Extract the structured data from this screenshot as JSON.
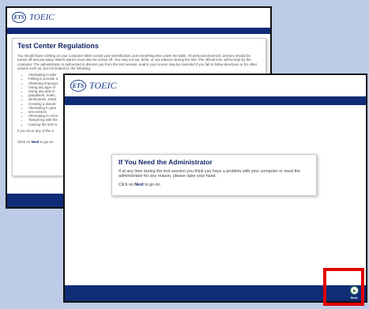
{
  "colors": {
    "brand_navy": "#0f2c77",
    "background": "#bccbe6",
    "highlight": "#e00000"
  },
  "back_window": {
    "logo_mark": "ETS",
    "logo_text": "TOEIC",
    "title": "Test Center Regulations",
    "intro": "You should have nothing on your computer table except your identification; put everything else under the table. All personal electronic devices should be turned off and put away. Watch alarms must also be turned off. You may not eat, drink, or use tobacco during the test. The official time will be kept by the computer. The administrator is authorized to dismiss you from the test session, and/or your scores may be canceled if you fail to follow directions or for other actions such as, but not limited to, the following:",
    "rules": [
      "Attempting to take",
      "Failing to provide a",
      "Obtaining improper",
      "Using any type of",
      "Using any aids in",
      "pamphlets, notes,",
      "dictionaries, transl",
      "Creating a disturb",
      "Attempting to give",
      "test session",
      "Attempting to remo",
      "Tampering with the",
      "Leaving the test ro"
    ],
    "note": "If you incur any of the a",
    "click_prefix": "Click on ",
    "click_next": "Next",
    "click_suffix": " to go on."
  },
  "front_window": {
    "logo_mark": "ETS",
    "logo_text": "TOEIC",
    "dialog": {
      "title": "If You Need the Administrator",
      "body": "If at any time during the test session you think you have a problem with your computer or need the administrator for any reason, please raise your hand.",
      "click_prefix": "Click on ",
      "click_next": "Next",
      "click_suffix": " to go on."
    },
    "next_button": {
      "icon": "arrow-right-circle-icon",
      "label": "Next"
    }
  }
}
